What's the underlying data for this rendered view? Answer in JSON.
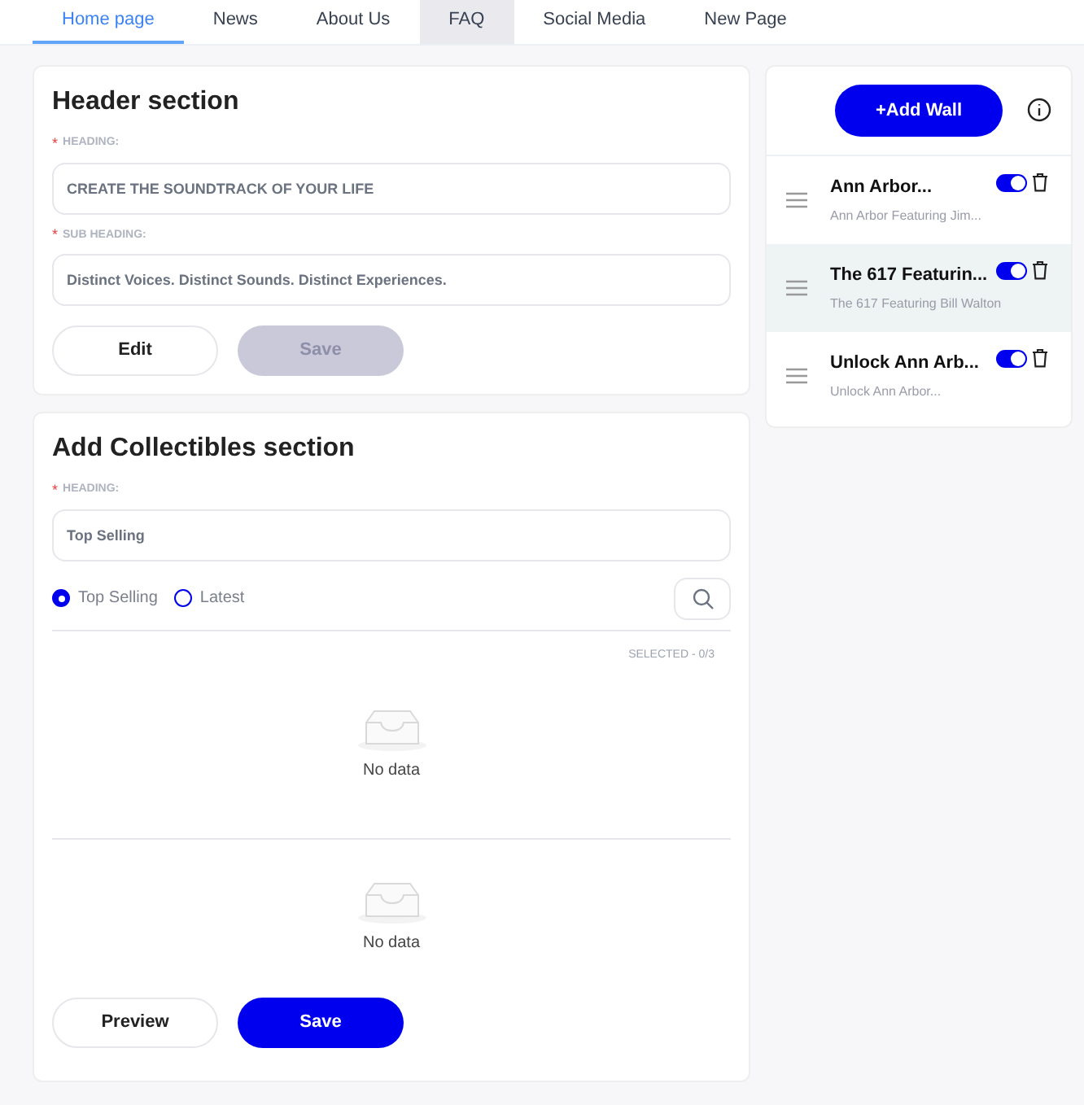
{
  "tabs": [
    {
      "label": "Home page",
      "selected": true,
      "highlighted": false
    },
    {
      "label": "News",
      "selected": false,
      "highlighted": false
    },
    {
      "label": "About Us",
      "selected": false,
      "highlighted": false
    },
    {
      "label": "FAQ",
      "selected": false,
      "highlighted": true
    },
    {
      "label": "Social Media",
      "selected": false,
      "highlighted": false
    },
    {
      "label": "New Page",
      "selected": false,
      "highlighted": false
    }
  ],
  "header_section": {
    "title": "Header section",
    "fields": [
      {
        "label": "HEADING:",
        "required_mark": "*",
        "value": "CREATE THE SOUNDTRACK OF YOUR LIFE"
      },
      {
        "label": "SUB HEADING:",
        "required_mark": "*",
        "value": "Distinct Voices. Distinct Sounds. Distinct Experiences."
      }
    ],
    "buttons": [
      {
        "label": "Edit",
        "kind": "outline",
        "disabled": false
      },
      {
        "label": "Save",
        "kind": "primary",
        "disabled": true
      }
    ]
  },
  "collectibles_section": {
    "title": "Add Collectibles section",
    "field": {
      "label": "HEADING:",
      "required_mark": "*",
      "value": "Top Selling"
    },
    "options": [
      {
        "label": "Top Selling",
        "selected": true
      },
      {
        "label": "Latest",
        "selected": false
      }
    ],
    "selected_count": "SELECTED - 0/3",
    "empty_lists": [
      {
        "text": "No data"
      },
      {
        "text": "No data"
      }
    ],
    "buttons": [
      {
        "label": "Preview",
        "kind": "outline",
        "disabled": false
      },
      {
        "label": "Save",
        "kind": "primary",
        "disabled": false
      }
    ]
  },
  "walls": {
    "add_button": "+Add Wall",
    "items": [
      {
        "title": "Ann Arbor...",
        "subtitle": "Ann Arbor Featuring Jim...",
        "on": true,
        "selected": false
      },
      {
        "title": "The 617 Featurin...",
        "subtitle": "The 617 Featuring Bill Walton",
        "on": true,
        "selected": true
      },
      {
        "title": "Unlock Ann Arb...",
        "subtitle": "Unlock Ann Arbor...",
        "on": true,
        "selected": false
      }
    ]
  }
}
